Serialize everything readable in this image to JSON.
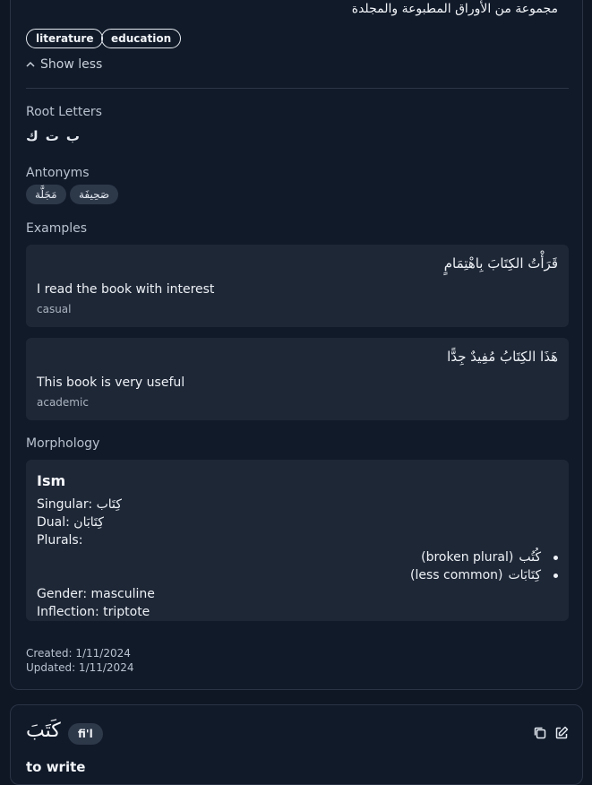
{
  "entry": {
    "definition_ar": "مجموعة من الأوراق المطبوعة والمجلدة",
    "tags": [
      "literature",
      "education"
    ],
    "show_less_label": "Show less",
    "root_letters_label": "Root Letters",
    "root_letters": [
      "ك",
      "ت",
      "ب"
    ],
    "antonyms_label": "Antonyms",
    "antonyms": [
      "صَحِيفَة",
      "مَجَلَّة"
    ],
    "examples_label": "Examples",
    "examples": [
      {
        "arabic": "قَرَأْتُ الكِتَابَ بِاهْتِمَامٍ",
        "english": "I read the book with interest",
        "register": "casual"
      },
      {
        "arabic": "هَذَا الكِتَابُ مُفِيدٌ جِدًّا",
        "english": "This book is very useful",
        "register": "academic"
      }
    ],
    "morphology_label": "Morphology",
    "morphology": {
      "title": "Ism",
      "singular": "Singular: كِتَاب",
      "dual": "Dual: كِتَابَان",
      "plurals_label": "Plurals:",
      "plurals": [
        {
          "word": "كُتُب",
          "note": "(broken plural)"
        },
        {
          "word": "كِتَابَات",
          "note": "(less common)"
        }
      ],
      "gender": "Gender: masculine",
      "inflection": "Inflection: triptote"
    },
    "created": "Created: 1/11/2024",
    "updated": "Updated: 1/11/2024"
  },
  "next_entry": {
    "word": "كَتَبَ",
    "pos": "fi'l",
    "translation": "to write",
    "icons": [
      "copy-icon",
      "edit-icon"
    ]
  },
  "colors": {
    "background": "#0f1724",
    "card": "#111a29",
    "panel": "#1e2736",
    "chip": "#2d3849"
  }
}
